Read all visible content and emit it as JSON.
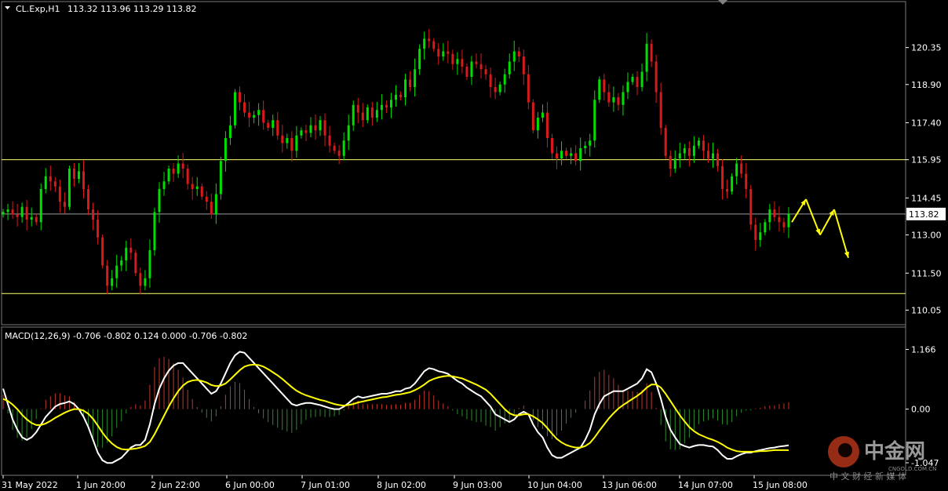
{
  "header": {
    "symbol": "CL.Exp,H1",
    "ohlc": "113.32 113.96 113.29 113.82"
  },
  "macd": {
    "label": "MACD(12,26,9) -0.706 -0.802 0.124 0.000 -0.706 -0.802",
    "axis_ticks": [
      "1.166",
      "0.00",
      "-1.047"
    ]
  },
  "watermark": {
    "name": "中金网",
    "subtitle": "中 文 财 经 新 媒 体",
    "url": "CNGOLD.COM.CN"
  },
  "colors": {
    "background": "#000000",
    "bull": "#00e000",
    "bear": "#d81a1a",
    "signal": "#ffff00",
    "macd_line": "#ffffff",
    "hline": "#ffff66",
    "axis": "#ffffff"
  },
  "chart_data": [
    {
      "type": "candlestick",
      "symbol": "CL.Exp,H1",
      "ylim": [
        109.6,
        121.6
      ],
      "yticks": [
        110.05,
        111.5,
        113.0,
        114.45,
        115.95,
        117.4,
        118.9,
        120.35
      ],
      "ytick_labels": [
        "110.05",
        "111.50",
        "113.00",
        "114.45",
        "115.95",
        "117.40",
        "118.90",
        "120.35"
      ],
      "current_price": "113.82",
      "x_labels": [
        "31 May 2022",
        "1 Jun 20:00",
        "2 Jun 22:00",
        "6 Jun 00:00",
        "7 Jun 01:00",
        "8 Jun 02:00",
        "9 Jun 03:00",
        "10 Jun 04:00",
        "13 Jun 06:00",
        "14 Jun 07:00",
        "15 Jun 08:00"
      ],
      "horizontal_lines": [
        115.95,
        113.82,
        110.7
      ],
      "closes": [
        113.9,
        114.0,
        113.8,
        113.7,
        114.1,
        113.6,
        113.7,
        113.5,
        114.8,
        115.3,
        115.1,
        114.9,
        114.3,
        114.1,
        115.6,
        115.2,
        115.5,
        114.8,
        114.0,
        113.6,
        112.9,
        111.8,
        111.0,
        111.3,
        111.8,
        112.0,
        112.5,
        112.3,
        111.5,
        111.0,
        111.3,
        112.4,
        113.9,
        114.8,
        115.1,
        115.6,
        115.4,
        115.8,
        115.6,
        115.0,
        114.8,
        114.9,
        114.5,
        114.3,
        113.8,
        114.6,
        115.9,
        116.8,
        117.3,
        118.6,
        118.2,
        117.8,
        117.6,
        117.7,
        117.9,
        117.4,
        117.2,
        117.5,
        116.9,
        116.6,
        116.8,
        116.3,
        116.9,
        117.1,
        117.0,
        117.3,
        117.1,
        117.5,
        116.9,
        116.5,
        116.3,
        116.1,
        116.7,
        117.3,
        118.1,
        117.8,
        117.5,
        118.0,
        117.6,
        117.9,
        118.1,
        118.0,
        118.3,
        118.5,
        118.4,
        119.1,
        118.8,
        119.5,
        120.3,
        120.7,
        120.6,
        120.3,
        120.0,
        120.2,
        120.1,
        119.7,
        119.9,
        119.6,
        119.2,
        119.8,
        119.7,
        119.5,
        119.3,
        118.8,
        118.6,
        118.9,
        119.3,
        119.8,
        120.2,
        120.0,
        119.3,
        118.2,
        117.1,
        117.6,
        117.8,
        116.8,
        116.2,
        116.0,
        116.3,
        116.1,
        116.2,
        115.9,
        116.4,
        116.5,
        116.7,
        118.3,
        119.1,
        118.6,
        118.2,
        118.4,
        118.1,
        118.6,
        119.0,
        119.2,
        118.8,
        119.4,
        120.5,
        119.8,
        118.6,
        117.2,
        116.1,
        115.6,
        116.0,
        116.2,
        116.4,
        116.1,
        116.5,
        116.7,
        116.3,
        116.0,
        116.2,
        115.7,
        114.8,
        114.7,
        115.3,
        115.8,
        115.4,
        114.8,
        113.4,
        112.8,
        113.1,
        113.5,
        114.0,
        113.7,
        113.5,
        113.3,
        113.82
      ],
      "projection": [
        113.5,
        114.4,
        113.0,
        114.0,
        112.1
      ],
      "series": [
        {
          "name": "MACD",
          "values": [
            0.4,
            0.1,
            -0.2,
            -0.4,
            -0.55,
            -0.6,
            -0.55,
            -0.45,
            -0.3,
            -0.15,
            -0.05,
            0.05,
            0.1,
            0.12,
            0.15,
            0.1,
            0.0,
            -0.15,
            -0.35,
            -0.6,
            -0.85,
            -1.0,
            -1.05,
            -1.05,
            -1.0,
            -0.95,
            -0.85,
            -0.75,
            -0.7,
            -0.7,
            -0.6,
            -0.3,
            0.1,
            0.4,
            0.6,
            0.75,
            0.85,
            0.9,
            0.9,
            0.8,
            0.7,
            0.6,
            0.5,
            0.4,
            0.3,
            0.35,
            0.5,
            0.7,
            0.9,
            1.05,
            1.12,
            1.1,
            1.0,
            0.9,
            0.8,
            0.7,
            0.6,
            0.5,
            0.4,
            0.3,
            0.2,
            0.1,
            0.07,
            0.1,
            0.12,
            0.12,
            0.1,
            0.08,
            0.05,
            0.02,
            0.0,
            0.0,
            0.05,
            0.12,
            0.2,
            0.25,
            0.22,
            0.24,
            0.26,
            0.28,
            0.3,
            0.3,
            0.32,
            0.35,
            0.35,
            0.4,
            0.42,
            0.5,
            0.62,
            0.74,
            0.8,
            0.78,
            0.74,
            0.72,
            0.69,
            0.62,
            0.55,
            0.5,
            0.42,
            0.36,
            0.3,
            0.25,
            0.15,
            0.05,
            -0.1,
            -0.15,
            -0.2,
            -0.25,
            -0.2,
            -0.1,
            -0.05,
            -0.1,
            -0.3,
            -0.45,
            -0.55,
            -0.75,
            -0.9,
            -0.95,
            -0.95,
            -0.9,
            -0.85,
            -0.8,
            -0.75,
            -0.6,
            -0.4,
            -0.1,
            0.1,
            0.25,
            0.3,
            0.35,
            0.35,
            0.35,
            0.4,
            0.45,
            0.5,
            0.6,
            0.78,
            0.72,
            0.5,
            0.2,
            -0.15,
            -0.4,
            -0.55,
            -0.68,
            -0.72,
            -0.75,
            -0.72,
            -0.7,
            -0.7,
            -0.72,
            -0.73,
            -0.8,
            -0.9,
            -0.97,
            -0.97,
            -0.92,
            -0.88,
            -0.85,
            -0.85,
            -0.82,
            -0.8,
            -0.78,
            -0.76,
            -0.75,
            -0.73,
            -0.72,
            -0.706
          ]
        },
        {
          "name": "Signal",
          "values": [
            0.2,
            0.16,
            0.09,
            0.0,
            -0.11,
            -0.2,
            -0.27,
            -0.31,
            -0.31,
            -0.28,
            -0.23,
            -0.17,
            -0.12,
            -0.07,
            -0.03,
            0.0,
            0.0,
            -0.03,
            -0.09,
            -0.19,
            -0.32,
            -0.46,
            -0.58,
            -0.67,
            -0.74,
            -0.78,
            -0.79,
            -0.78,
            -0.77,
            -0.75,
            -0.72,
            -0.64,
            -0.49,
            -0.31,
            -0.13,
            0.05,
            0.21,
            0.35,
            0.46,
            0.53,
            0.56,
            0.57,
            0.55,
            0.52,
            0.47,
            0.45,
            0.46,
            0.5,
            0.58,
            0.67,
            0.76,
            0.83,
            0.86,
            0.87,
            0.86,
            0.83,
            0.78,
            0.72,
            0.66,
            0.59,
            0.51,
            0.43,
            0.36,
            0.31,
            0.27,
            0.24,
            0.21,
            0.18,
            0.16,
            0.13,
            0.1,
            0.08,
            0.07,
            0.08,
            0.1,
            0.13,
            0.15,
            0.17,
            0.19,
            0.21,
            0.23,
            0.24,
            0.26,
            0.28,
            0.29,
            0.31,
            0.33,
            0.37,
            0.42,
            0.48,
            0.55,
            0.59,
            0.62,
            0.64,
            0.65,
            0.64,
            0.62,
            0.6,
            0.56,
            0.52,
            0.48,
            0.43,
            0.38,
            0.3,
            0.2,
            0.1,
            0.0,
            -0.08,
            -0.12,
            -0.12,
            -0.1,
            -0.1,
            -0.14,
            -0.2,
            -0.27,
            -0.37,
            -0.48,
            -0.58,
            -0.65,
            -0.7,
            -0.73,
            -0.75,
            -0.75,
            -0.72,
            -0.66,
            -0.55,
            -0.42,
            -0.3,
            -0.18,
            -0.08,
            0.01,
            0.08,
            0.14,
            0.2,
            0.26,
            0.33,
            0.42,
            0.48,
            0.48,
            0.42,
            0.3,
            0.16,
            0.02,
            -0.12,
            -0.24,
            -0.35,
            -0.43,
            -0.49,
            -0.53,
            -0.57,
            -0.6,
            -0.64,
            -0.69,
            -0.75,
            -0.79,
            -0.82,
            -0.83,
            -0.83,
            -0.83,
            -0.83,
            -0.82,
            -0.82,
            -0.81,
            -0.8,
            -0.8,
            -0.8,
            -0.802
          ]
        }
      ]
    }
  ]
}
